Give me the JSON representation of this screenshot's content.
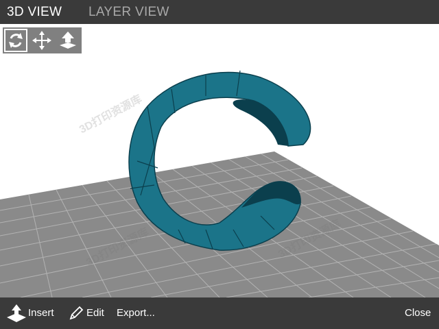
{
  "tabs": [
    {
      "label": "3D VIEW",
      "active": true
    },
    {
      "label": "LAYER VIEW",
      "active": false
    }
  ],
  "tools": [
    {
      "name": "rotate",
      "icon": "rotate-icon",
      "active": true
    },
    {
      "name": "move",
      "icon": "move-icon",
      "active": false
    },
    {
      "name": "lay-flat",
      "icon": "lay-flat-icon",
      "active": false
    }
  ],
  "bottom": {
    "insert_label": "Insert",
    "edit_label": "Edit",
    "export_label": "Export...",
    "close_label": "Close"
  },
  "colors": {
    "model": "#1b7489",
    "model_dark": "#0b3f4d",
    "bed": "#8a8a8a",
    "grid": "#b3b3b3"
  }
}
